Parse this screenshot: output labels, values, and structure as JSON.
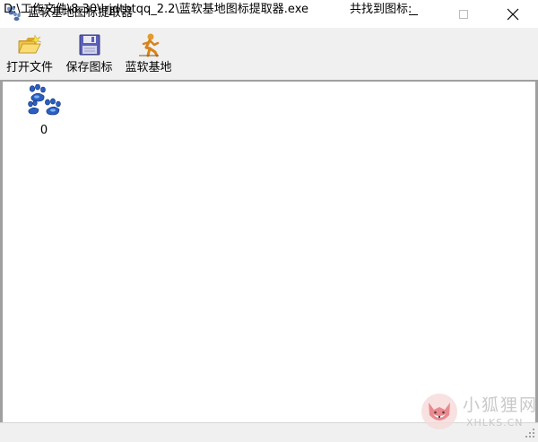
{
  "window": {
    "title": "蓝软基地图标提取器",
    "controls": {
      "minimize_icon": "minimize-icon",
      "maximize_icon": "maximize-icon",
      "close_icon": "close-icon"
    }
  },
  "toolbar": {
    "items": [
      {
        "label": "打开文件",
        "icon": "open-folder-icon"
      },
      {
        "label": "保存图标",
        "icon": "floppy-save-icon"
      },
      {
        "label": "蓝软基地",
        "icon": "running-man-icon"
      }
    ]
  },
  "icon_list": {
    "items": [
      {
        "label": "0",
        "icon": "paw-prints-icon"
      }
    ]
  },
  "statusbar": {
    "path": "D:\\工作文件\\8.30\\lrjdtbtqq_2.2\\蓝软基地图标提取器.exe",
    "count_text": "共找到图标:"
  },
  "watermark": {
    "text": "小狐狸网",
    "domain": "XHLKS.CN"
  },
  "colors": {
    "toolbar_bg": "#f0f0f0",
    "status_bg": "#f0f0f0",
    "paw_blue": "#2a5fc2",
    "watermark_pink": "#e98a8f"
  }
}
